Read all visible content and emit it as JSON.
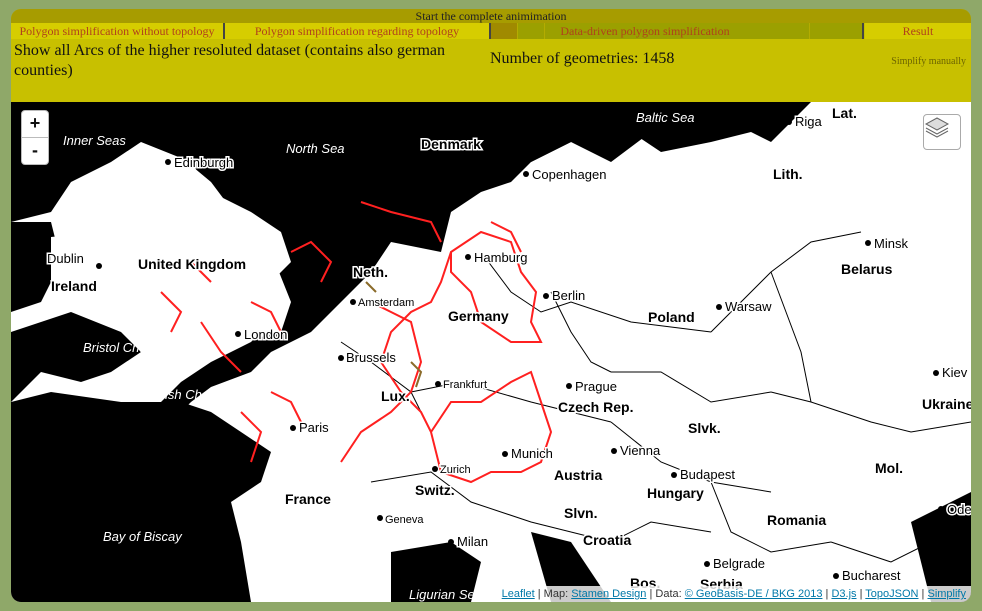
{
  "header": {
    "start_label": "Start the complete animimation",
    "tabs": [
      {
        "label": "Polygon simplification without topology"
      },
      {
        "label": "Polygon simplification regarding topology"
      },
      {
        "label": "Data-driven polygon simplification"
      },
      {
        "label": "Result"
      }
    ]
  },
  "info": {
    "description": "Show all Arcs of the higher resoluted dataset (contains also german counties)",
    "geometry_count": "Number of geometries: 1458",
    "simplify_label": "Simplify manually"
  },
  "map": {
    "zoom_in": "+",
    "zoom_out": "-",
    "labels": {
      "seas": [
        "Inner Seas",
        "North Sea",
        "Baltic Sea",
        "Bristol Channel",
        "English Channel",
        "Bay of Biscay",
        "Ligurian Sea"
      ],
      "countries": [
        "Denmark",
        "Lat.",
        "Lith.",
        "Belarus",
        "Ireland",
        "United Kingdom",
        "Neth.",
        "Germany",
        "Poland",
        "Ukraine",
        "Lux.",
        "Czech Rep.",
        "Slvk.",
        "Mol.",
        "France",
        "Austria",
        "Hungary",
        "Switz.",
        "Romania",
        "Slvn.",
        "Croatia",
        "Bos.",
        "Serbia"
      ],
      "cities": [
        "Edinburgh",
        "Riga",
        "Copenhagen",
        "Minsk",
        "Dublin",
        "Hamburg",
        "Amsterdam",
        "Berlin",
        "Warsaw",
        "London",
        "Brussels",
        "Prague",
        "Frankfurt",
        "Kiev",
        "Paris",
        "Vienna",
        "Munich",
        "Budapest",
        "Zurich",
        "Geneva",
        "Milan",
        "Belgrade",
        "Bucharest",
        "Ode"
      ]
    },
    "attribution": {
      "leaflet": "Leaflet",
      "map_prefix": " | Map: ",
      "stamen": "Stamen Design",
      "data_prefix": " | Data: ",
      "geobasis": "© GeoBasis-DE / BKG 2013",
      "sep1": " | ",
      "d3": "D3.js",
      "sep2": " | ",
      "topojson": "TopoJSON",
      "sep3": " | ",
      "simplify": "Simplify"
    }
  },
  "colors": {
    "accent": "#c8c000",
    "arcs": "#ff2020",
    "water": "#000000"
  }
}
